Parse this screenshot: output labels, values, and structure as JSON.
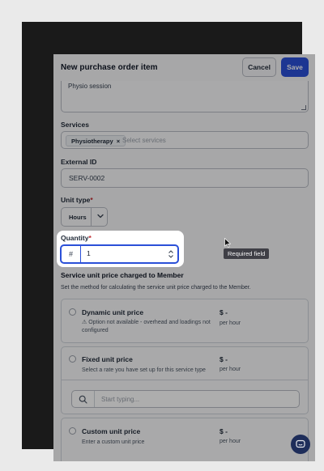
{
  "header": {
    "title": "New purchase order item",
    "cancel_label": "Cancel",
    "save_label": "Save"
  },
  "description": {
    "value": "Physio session"
  },
  "services": {
    "label": "Services",
    "chips": [
      "Physiotherapy"
    ],
    "chip_remove": "×",
    "placeholder": "Select services"
  },
  "external_id": {
    "label": "External ID",
    "value": "SERV-0002"
  },
  "unit_type": {
    "label": "Unit type",
    "required_marker": "*",
    "value": "Hours"
  },
  "quantity": {
    "label": "Quantity",
    "required_marker": "*",
    "prefix": "#",
    "value": "1"
  },
  "tooltip": {
    "text": "Required field"
  },
  "pricing": {
    "title": "Service unit price charged to Member",
    "description": "Set the method for calculating the service unit price charged to the Member.",
    "options": [
      {
        "title": "Dynamic unit price",
        "description": "⚠ Option not available - overhead and loadings not configured",
        "price": "$ -",
        "unit": "per hour"
      },
      {
        "title": "Fixed unit price",
        "description": "Select a rate you have set up for this service type",
        "price": "$ -",
        "unit": "per hour"
      },
      {
        "title": "Custom unit price",
        "description": "Enter a custom unit price",
        "price": "$ -",
        "unit": "per hour"
      }
    ],
    "search_placeholder": "Start typing..."
  },
  "colors": {
    "primary": "#2b50d8",
    "required": "#c0262d",
    "chat": "#1e2d5a",
    "overlay": "#000000"
  },
  "icons": {
    "chevron": "chevron-down-icon",
    "search": "search-icon",
    "spinner": "stepper-arrows-icon",
    "chat": "chat-icon",
    "cursor": "mouse-pointer-icon"
  }
}
